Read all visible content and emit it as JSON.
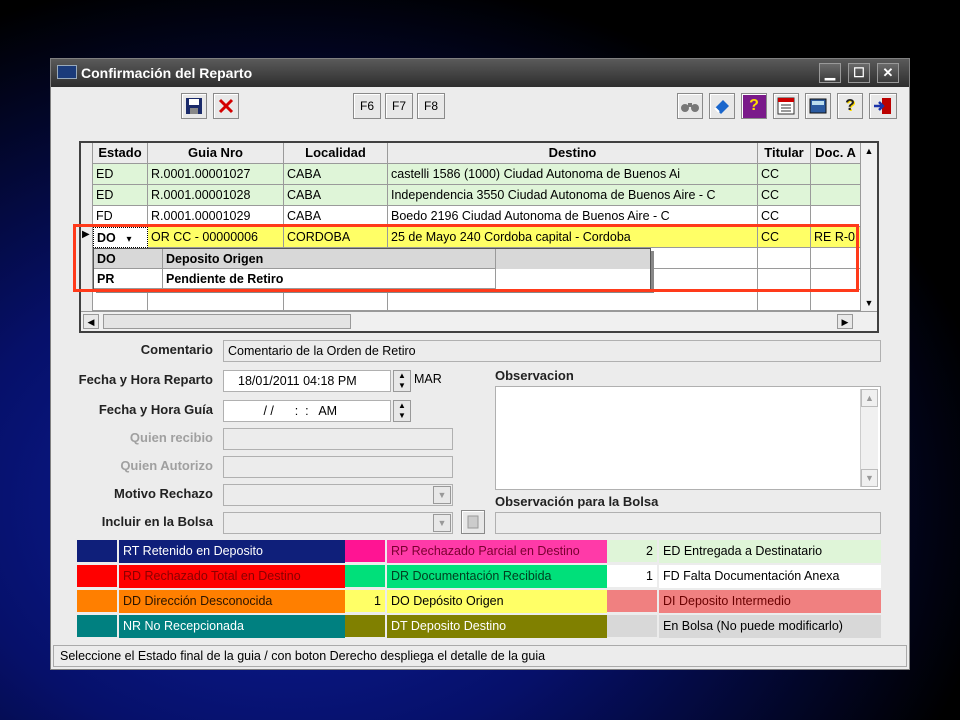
{
  "window": {
    "title": "Confirmación del Reparto"
  },
  "toolbar": {
    "f6": "F6",
    "f7": "F7",
    "f8": "F8",
    "help": "?"
  },
  "grid": {
    "headers": [
      "Estado",
      "Guia Nro",
      "Localidad",
      "Destino",
      "Titular",
      "Doc. A"
    ],
    "rows": [
      [
        "ED",
        "R.0001.00001027",
        "CABA",
        "castelli 1586 (1000) Ciudad Autonoma de Buenos Ai",
        "CC",
        ""
      ],
      [
        "ED",
        "R.0001.00001028",
        "CABA",
        "Independencia 3550 Ciudad Autonoma de Buenos Aire - C",
        "CC",
        ""
      ],
      [
        "FD",
        "R.0001.00001029",
        "CABA",
        "Boedo 2196 Ciudad Autonoma de Buenos Aire - C",
        "CC",
        ""
      ],
      [
        "DO",
        "OR  CC - 00000006",
        "CORDOBA",
        "25 de Mayo 240 Cordoba capital - Cordoba",
        "CC",
        "RE R-0"
      ]
    ],
    "row_marker": "▶",
    "dropdown": [
      [
        "DO",
        "Deposito Origen"
      ],
      [
        "PR",
        "Pendiente de Retiro"
      ]
    ]
  },
  "form": {
    "comentario_label": "Comentario",
    "comentario_value": "Comentario de la Orden de Retiro",
    "fecha_reparto_label": "Fecha y Hora Reparto",
    "fecha_reparto_value": "18/01/2011 04:18 PM",
    "fecha_reparto_day": "MAR",
    "fecha_guia_label": "Fecha y Hora Guía",
    "fecha_guia_value": " / /      :  :   AM",
    "quien_recibio_label": "Quien recibio",
    "quien_autorizo_label": "Quien Autorizo",
    "motivo_rechazo_label": "Motivo Rechazo",
    "incluir_bolsa_label": "Incluir en la Bolsa",
    "observacion_label": "Observacion",
    "observacion_bolsa_label": "Observación para la Bolsa"
  },
  "legend": [
    {
      "count": "",
      "text": "RT Retenido en Deposito",
      "color": "#0f1f7a",
      "textColor": "#ffffff",
      "bg": "#0f1f7a"
    },
    {
      "count": "",
      "text": "RP Rechazado Parcial en Destino",
      "color": "#ff1493",
      "textColor": "#7a0030",
      "bg": "#ff3aa8"
    },
    {
      "count": "2",
      "text": "ED Entregada a Destinatario",
      "color": "#dff5d8",
      "textColor": "#000000",
      "bg": "#dff5d8"
    },
    {
      "count": "",
      "text": "RD Rechazado Total en Destino",
      "color": "#ff0000",
      "textColor": "#8a0000",
      "bg": "#ff0000"
    },
    {
      "count": "",
      "text": "DR Documentación Recibida",
      "color": "#00e07a",
      "textColor": "#004020",
      "bg": "#00e07a"
    },
    {
      "count": "1",
      "text": "FD Falta Documentación Anexa",
      "color": "#ffffff",
      "textColor": "#000000",
      "bg": "#ffffff"
    },
    {
      "count": "",
      "text": "DD Dirección Desconocida",
      "color": "#ff7f00",
      "textColor": "#2a1400",
      "bg": "#ff7f00"
    },
    {
      "count": "1",
      "text": "DO Depósito Origen",
      "color": "#ffff66",
      "textColor": "#000000",
      "bg": "#ffff66"
    },
    {
      "count": "",
      "text": "DI Deposito Intermedio",
      "color": "#f08080",
      "textColor": "#6a0000",
      "bg": "#f08080"
    },
    {
      "count": "",
      "text": "NR No Recepcionada",
      "color": "#008080",
      "textColor": "#ffffff",
      "bg": "#008080"
    },
    {
      "count": "",
      "text": "DT Deposito Destino",
      "color": "#808000",
      "textColor": "#ffffff",
      "bg": "#808000"
    },
    {
      "count": "",
      "text": "En Bolsa (No puede modificarlo)",
      "color": "#d8d8d8",
      "textColor": "#000000",
      "bg": "#d8d8d8"
    }
  ],
  "status_text": "Seleccione el Estado final de la guia / con boton Derecho despliega el detalle de la guia",
  "colors": {
    "highlight_row": "#ffff66",
    "delivered_row": "#dff5d8",
    "annotation_box": "#ff3a1a"
  }
}
